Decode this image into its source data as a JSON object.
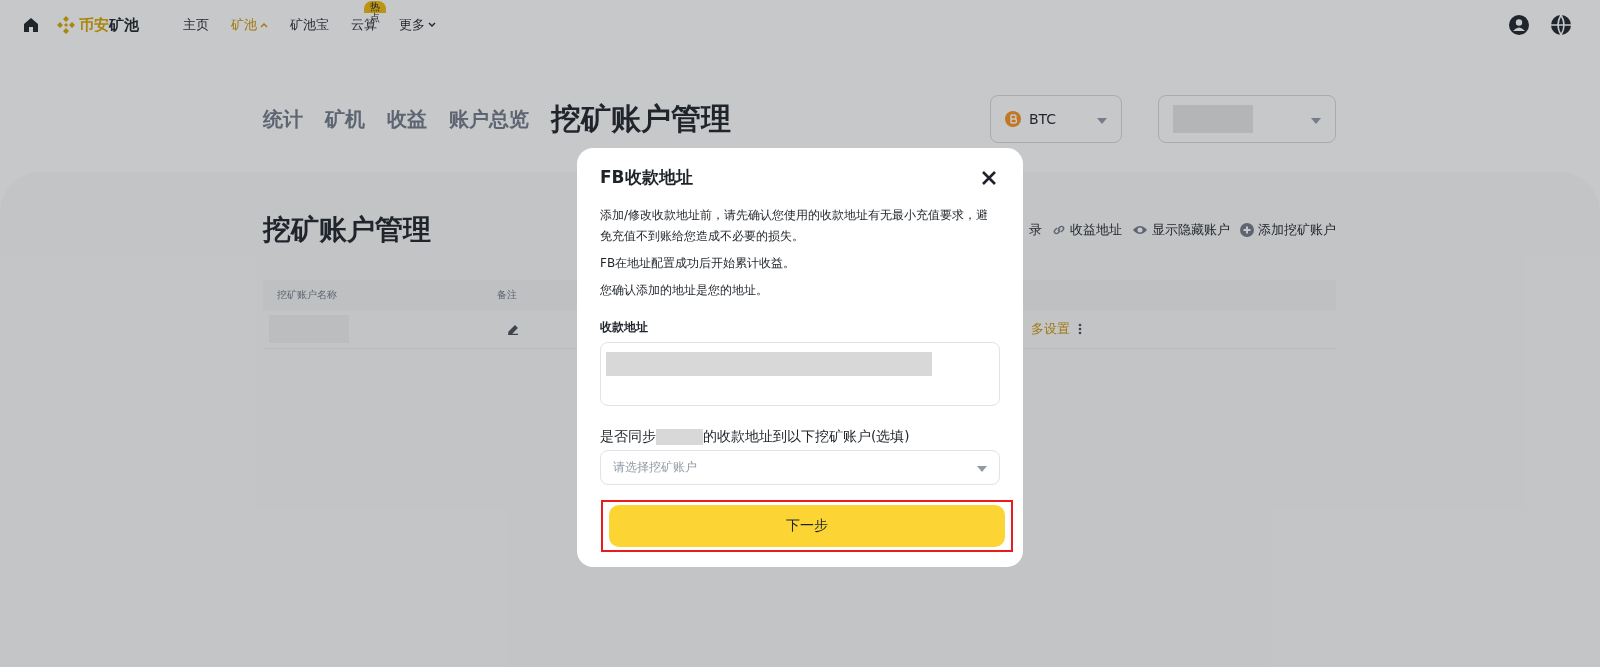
{
  "header": {
    "brand_primary": "币安",
    "brand_secondary": "矿池",
    "nav": [
      {
        "label": "主页",
        "selected": false,
        "caret": false
      },
      {
        "label": "矿池",
        "selected": true,
        "caret": true
      },
      {
        "label": "矿池宝",
        "selected": false,
        "caret": false
      },
      {
        "label": "云算",
        "selected": false,
        "caret": false,
        "badge": "热点"
      },
      {
        "label": "更多",
        "selected": false,
        "caret": true
      }
    ]
  },
  "tabs": [
    {
      "label": "统计",
      "selected": false
    },
    {
      "label": "矿机",
      "selected": false
    },
    {
      "label": "收益",
      "selected": false
    },
    {
      "label": "账户总览",
      "selected": false
    },
    {
      "label": "挖矿账户管理",
      "selected": true
    }
  ],
  "coin_select": {
    "value": "BTC"
  },
  "section": {
    "title": "挖矿账户管理",
    "actions": [
      {
        "kind": "text",
        "label": "录"
      },
      {
        "kind": "link",
        "label": "收益地址"
      },
      {
        "kind": "eye",
        "label": "显示隐藏账户"
      },
      {
        "kind": "plus",
        "label": "添加挖矿账户"
      }
    ],
    "table": {
      "columns": [
        "挖矿账户名称",
        "备注"
      ],
      "row_action": "多设置"
    }
  },
  "dialog": {
    "title": "FB收款地址",
    "paragraphs": [
      "添加/修改收款地址前，请先确认您使用的收款地址有无最小充值要求，避免充值不到账给您造成不必要的损失。",
      "FB在地址配置成功后开始累计收益。",
      "您确认添加的地址是您的地址。"
    ],
    "address_label": "收款地址",
    "sync_label_before": "是否同步",
    "sync_label_after": "的收款地址到以下挖矿账户(选填)",
    "account_select": {
      "placeholder": "请选择挖矿账户"
    },
    "next_button": "下一步",
    "button_highlighted": true
  }
}
